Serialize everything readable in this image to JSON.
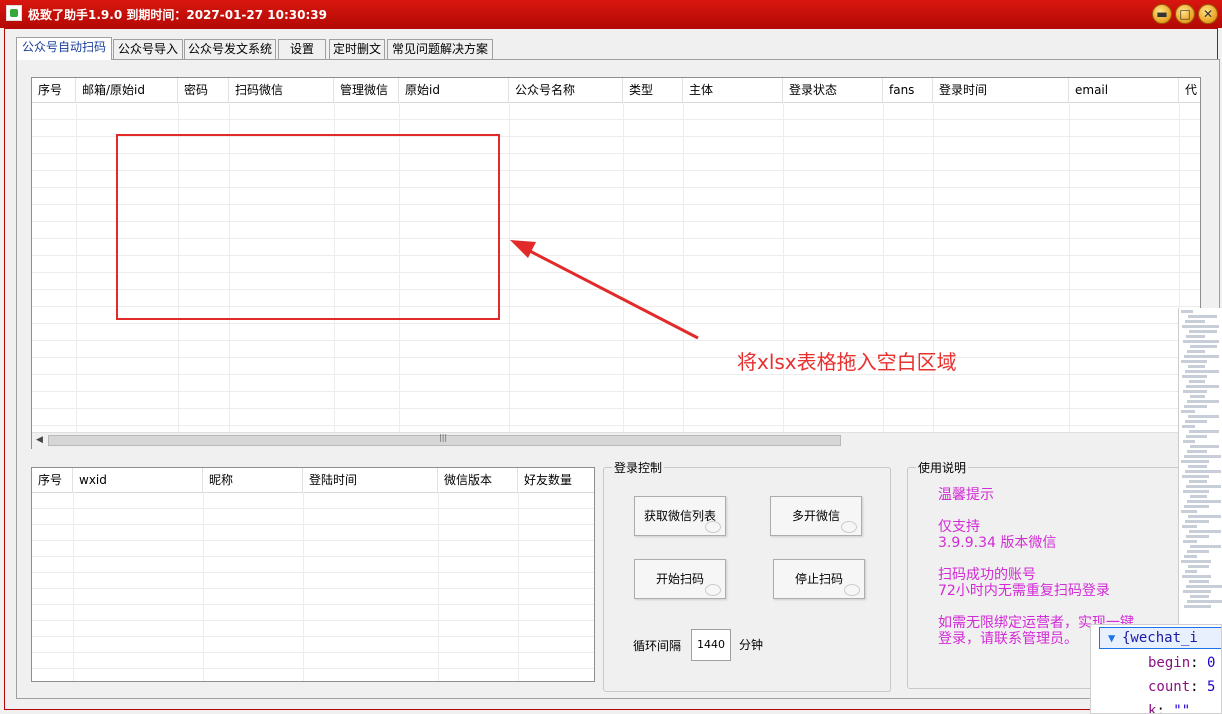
{
  "window": {
    "title": "极致了助手1.9.0  到期时间：2027-01-27 10:30:39",
    "buttons": {
      "minimize": "▬",
      "maximize": "□",
      "close": "✕"
    }
  },
  "tabs": [
    {
      "label": "公众号自动扫码",
      "active": true
    },
    {
      "label": "公众号导入",
      "active": false
    },
    {
      "label": "公众号发文系统",
      "active": false
    },
    {
      "label": "设置",
      "active": false
    },
    {
      "label": "定时删文",
      "active": false
    },
    {
      "label": "常见问题解决方案",
      "active": false
    }
  ],
  "account_table": {
    "columns": [
      "序号",
      "邮箱/原始id",
      "密码",
      "扫码微信",
      "管理微信",
      "原始id",
      "公众号名称",
      "类型",
      "主体",
      "登录状态",
      "fans",
      "登录时间",
      "email",
      "代"
    ],
    "rows": []
  },
  "drop_hint": "将xlsx表格拖入空白区域",
  "wechat_table": {
    "columns": [
      "序号",
      "wxid",
      "昵称",
      "登陆时间",
      "微信版本",
      "好友数量"
    ],
    "rows": []
  },
  "login_control": {
    "title": "登录控制",
    "get_list_label": "获取微信列表",
    "multi_open_label": "多开微信",
    "start_scan_label": "开始扫码",
    "stop_scan_label": "停止扫码",
    "interval_label": "循环间隔",
    "interval_value": "1440",
    "interval_unit": "分钟"
  },
  "usage": {
    "title": "使用说明",
    "lines": [
      "温馨提示",
      "仅支持",
      "3.9.9.34 版本微信",
      "扫码成功的账号",
      "72小时内无需重复扫码登录",
      "如需无限绑定运营者，实现一键",
      "登录，请联系管理员。"
    ]
  },
  "devtools": {
    "header": "{wechat_i",
    "lines": [
      {
        "key": "begin",
        "value": "0"
      },
      {
        "key": "count",
        "value": "5"
      },
      {
        "key": "k",
        "value": "\"\""
      }
    ]
  },
  "colors": {
    "titlebar": "#c8100a",
    "accent_red": "#e8302e",
    "usage_text": "#d22bd6"
  }
}
